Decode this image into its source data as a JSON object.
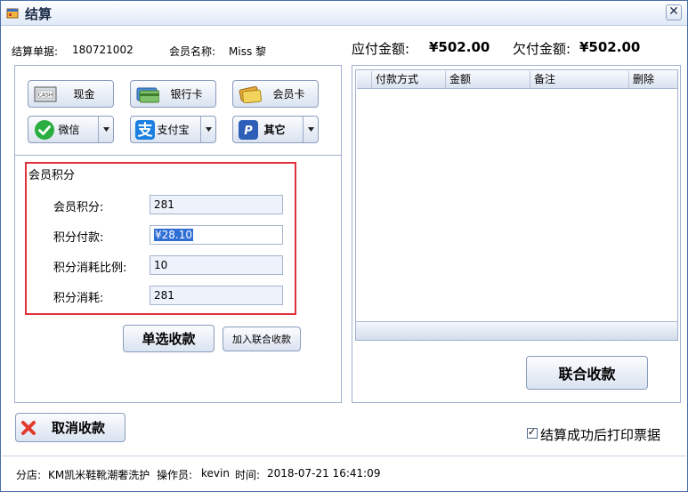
{
  "window": {
    "title": "结算"
  },
  "header": {
    "bill_no_label": "结算单据:",
    "bill_no": "180721002",
    "member_name_label": "会员名称:",
    "member_name": "Miss 黎",
    "amount_due_label": "应付金额:",
    "amount_due": "¥502.00",
    "amount_owed_label": "欠付金额:",
    "amount_owed": "¥502.00"
  },
  "payment_methods": {
    "cash": "现金",
    "bank_card": "银行卡",
    "member_card": "会员卡",
    "wechat": "微信",
    "alipay": "支付宝",
    "other": "其它"
  },
  "member_points": {
    "title": "会员积分",
    "points_label": "会员积分:",
    "points_value": "281",
    "points_payment_label": "积分付款:",
    "points_payment_value": "¥28.10",
    "ratio_label": "积分消耗比例:",
    "ratio_value": "10",
    "consumed_label": "积分消耗:",
    "consumed_value": "281"
  },
  "actions": {
    "single_pay": "单选收款",
    "add_combined": "加入联合收款",
    "combined_pay": "联合收款",
    "cancel_pay": "取消收款",
    "print_after_label": "结算成功后打印票据",
    "print_after_checked": "✓"
  },
  "grid": {
    "columns": [
      "付款方式",
      "金额",
      "备注",
      "删除"
    ]
  },
  "status": {
    "branch_label": "分店:",
    "branch": "KM凯米鞋靴潮奢洗护",
    "operator_label": "操作员:",
    "operator": "kevin",
    "time_label": "时间:",
    "time": "2018-07-21 16:41:09"
  },
  "colors": {
    "highlight_border": "#e0303a",
    "wechat_green": "#2aae3f",
    "alipay_blue": "#1a7fe0",
    "other_blue": "#2d5fb8",
    "cancel_red": "#e23b2e"
  }
}
